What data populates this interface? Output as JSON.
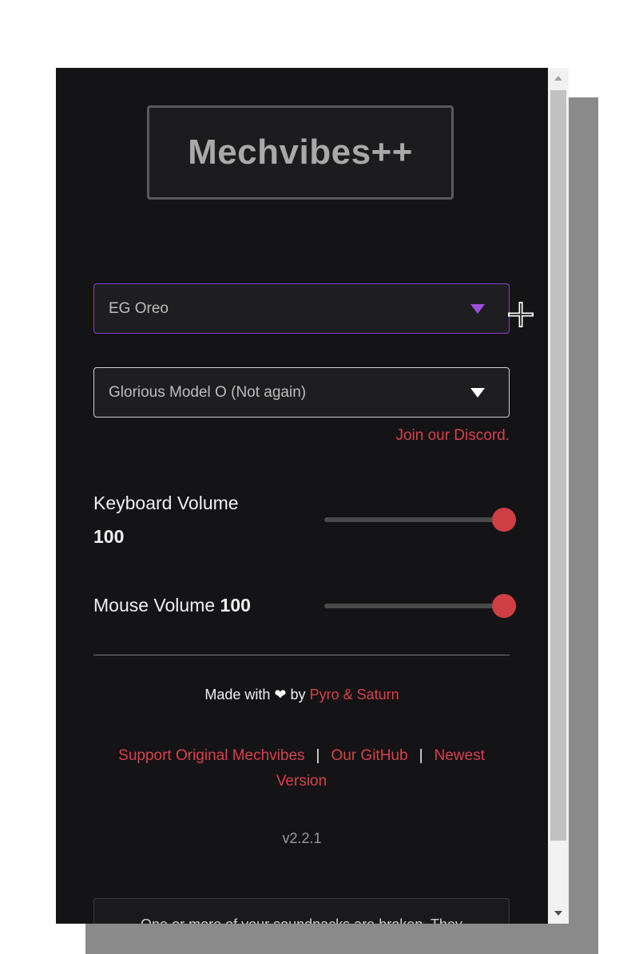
{
  "app": {
    "title": "Mechvibes++"
  },
  "keyboard_pack": {
    "selected": "EG Oreo"
  },
  "mouse_pack": {
    "selected": "Glorious Model O (Not again)"
  },
  "discord": {
    "label": "Join our Discord."
  },
  "keyboard_volume": {
    "label": "Keyboard Volume",
    "value": "100",
    "fraction": 1.0
  },
  "mouse_volume": {
    "label": "Mouse Volume",
    "value": "100",
    "fraction": 1.0
  },
  "footer": {
    "made_with": "Made with",
    "by": "by",
    "authors": "Pyro & Saturn",
    "links": [
      {
        "label": "Support Original Mechvibes"
      },
      {
        "label": "Our GitHub"
      },
      {
        "label": "Newest Version"
      }
    ],
    "separator": "|",
    "version": "v2.2.1"
  },
  "notice": {
    "text": "One or more of your soundpacks are broken. They"
  },
  "colors": {
    "background": "#141316",
    "accent_red": "#d7424a",
    "accent_purple": "#8a3fc8",
    "slider_thumb": "#cf3f44"
  },
  "icons": {
    "heart": "heart-icon",
    "dropdown": "triangle-down-icon",
    "cursor": "move-cursor-icon"
  }
}
